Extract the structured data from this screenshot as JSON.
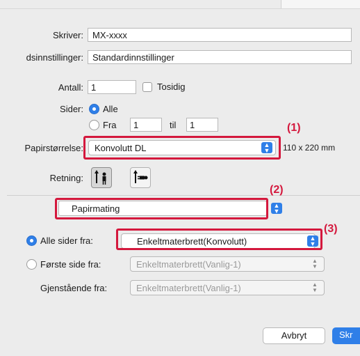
{
  "printer": {
    "label": "Skriver:",
    "value": "MX-xxxx"
  },
  "presets": {
    "label": "dsinnstillinger:",
    "value": "Standardinnstillinger"
  },
  "copies": {
    "label": "Antall:",
    "value": "1",
    "duplex_label": "Tosidig",
    "duplex_checked": false
  },
  "pages": {
    "label": "Sider:",
    "all_label": "Alle",
    "from_label": "Fra",
    "from_value": "1",
    "to_label": "til",
    "to_value": "1",
    "selected": "all"
  },
  "paper_size": {
    "label": "Papirstørrelse:",
    "value": "Konvolutt DL",
    "dims": "110 x 220 mm"
  },
  "orientation": {
    "label": "Retning:",
    "selected": "portrait"
  },
  "section": {
    "value": "Papirmating"
  },
  "paper_feed": {
    "all_pages": {
      "label": "Alle sider fra:",
      "value": "Enkeltmaterbrett(Konvolutt)",
      "selected": true
    },
    "first_page": {
      "label": "Første side fra:",
      "value": "Enkeltmaterbrett(Vanlig-1)",
      "selected": false
    },
    "remaining": {
      "label": "Gjenstående fra:",
      "value": "Enkeltmaterbrett(Vanlig-1)"
    }
  },
  "buttons": {
    "cancel": "Avbryt",
    "print": "Skr"
  },
  "callouts": {
    "c1": "(1)",
    "c2": "(2)",
    "c3": "(3)"
  },
  "colors": {
    "accent": "#2f7fe8",
    "callout": "#d4183d",
    "background": "#ececec"
  },
  "icons": [
    "checkbox-icon",
    "radio-icon",
    "portrait-icon",
    "landscape-icon",
    "chevron-updown-icon"
  ]
}
